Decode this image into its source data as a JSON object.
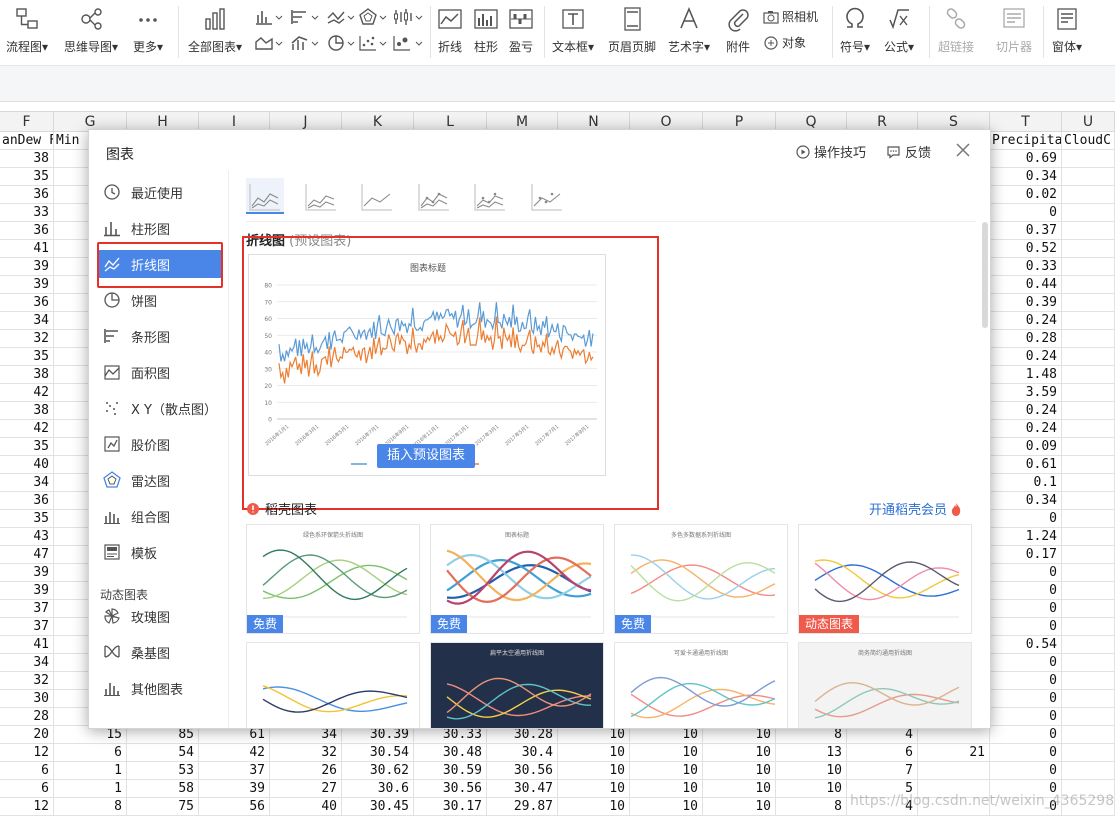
{
  "ribbon": {
    "items": [
      {
        "label": "流程图▾",
        "icon": "flowchart-icon"
      },
      {
        "label": "思维导图▾",
        "icon": "mindmap-icon"
      },
      {
        "label": "更多▾",
        "icon": "more-dots-icon"
      },
      {
        "label": "全部图表▾",
        "icon": "all-charts-icon"
      },
      {
        "label": "折线",
        "icon": "line-chart-icon"
      },
      {
        "label": "柱形",
        "icon": "column-chart-icon"
      },
      {
        "label": "盈亏",
        "icon": "win-loss-icon"
      },
      {
        "label": "文本框▾",
        "icon": "textbox-icon"
      },
      {
        "label": "页眉页脚",
        "icon": "header-footer-icon"
      },
      {
        "label": "艺术字▾",
        "icon": "wordart-icon"
      },
      {
        "label": "附件",
        "icon": "attachment-icon"
      },
      {
        "label": "照相机",
        "icon": "camera-icon"
      },
      {
        "label": "对象",
        "icon": "object-icon"
      },
      {
        "label": "符号▾",
        "icon": "omega-symbol-icon"
      },
      {
        "label": "公式▾",
        "icon": "formula-icon"
      },
      {
        "label": "超链接",
        "icon": "hyperlink-icon"
      },
      {
        "label": "切片器",
        "icon": "slicer-icon"
      },
      {
        "label": "窗体▾",
        "icon": "form-icon"
      }
    ]
  },
  "columns": [
    "F",
    "G",
    "H",
    "I",
    "J",
    "K",
    "L",
    "M",
    "N",
    "O",
    "P",
    "Q",
    "R",
    "S",
    "T",
    "U"
  ],
  "header_row": {
    "F": "anDew F",
    "G": "Min",
    "T": "Precipita",
    "U": "CloudC"
  },
  "col_F": [
    "38",
    "35",
    "36",
    "33",
    "36",
    "41",
    "39",
    "39",
    "36",
    "34",
    "32",
    "35",
    "38",
    "42",
    "38",
    "42",
    "35",
    "40",
    "34",
    "36",
    "35",
    "43",
    "47",
    "39",
    "39",
    "37",
    "37",
    "41",
    "34",
    "32",
    "30",
    "28",
    "20",
    "12",
    "6",
    "6",
    "12"
  ],
  "col_T": [
    "0.69",
    "0.34",
    "0.02",
    "0",
    "0.37",
    "0.52",
    "0.33",
    "0.44",
    "0.39",
    "0.24",
    "0.28",
    "0.24",
    "1.48",
    "3.59",
    "0.24",
    "0.24",
    "0.09",
    "0.61",
    "0.1",
    "0.34",
    "0",
    "1.24",
    "0.17",
    "0",
    "0",
    "0",
    "0",
    "0.54",
    "0",
    "0",
    "0",
    "0",
    "0",
    "0",
    "0",
    "0",
    "0"
  ],
  "bottom_rows": [
    {
      "F": "20",
      "G": "15",
      "H": "85",
      "I": "61",
      "J": "34",
      "K": "30.39",
      "L": "30.33",
      "M": "30.28",
      "N": "10",
      "O": "10",
      "P": "10",
      "Q": "8",
      "R": "4",
      "S": "",
      "T": "0"
    },
    {
      "F": "12",
      "G": "6",
      "H": "54",
      "I": "42",
      "J": "32",
      "K": "30.54",
      "L": "30.48",
      "M": "30.4",
      "N": "10",
      "O": "10",
      "P": "10",
      "Q": "13",
      "R": "6",
      "S": "21",
      "T": "0"
    },
    {
      "F": "6",
      "G": "1",
      "H": "53",
      "I": "37",
      "J": "26",
      "K": "30.62",
      "L": "30.59",
      "M": "30.56",
      "N": "10",
      "O": "10",
      "P": "10",
      "Q": "10",
      "R": "7",
      "S": "",
      "T": "0"
    },
    {
      "F": "6",
      "G": "1",
      "H": "58",
      "I": "39",
      "J": "27",
      "K": "30.6",
      "L": "30.56",
      "M": "30.47",
      "N": "10",
      "O": "10",
      "P": "10",
      "Q": "10",
      "R": "5",
      "S": "",
      "T": "0"
    },
    {
      "F": "12",
      "G": "8",
      "H": "75",
      "I": "56",
      "J": "40",
      "K": "30.45",
      "L": "30.17",
      "M": "29.87",
      "N": "10",
      "O": "10",
      "P": "10",
      "Q": "8",
      "R": "4",
      "S": "",
      "T": "0"
    }
  ],
  "dialog": {
    "title": "图表",
    "tips": "操作技巧",
    "feedback": "反馈",
    "sidebar": [
      {
        "label": "最近使用",
        "icon": "clock-icon"
      },
      {
        "label": "柱形图",
        "icon": "column-chart-icon"
      },
      {
        "label": "折线图",
        "icon": "line-chart-icon"
      },
      {
        "label": "饼图",
        "icon": "pie-chart-icon"
      },
      {
        "label": "条形图",
        "icon": "bar-chart-icon"
      },
      {
        "label": "面积图",
        "icon": "area-chart-icon"
      },
      {
        "label": "X Y（散点图）",
        "icon": "scatter-chart-icon"
      },
      {
        "label": "股价图",
        "icon": "stock-chart-icon"
      },
      {
        "label": "雷达图",
        "icon": "radar-chart-icon"
      },
      {
        "label": "组合图",
        "icon": "combo-chart-icon"
      },
      {
        "label": "模板",
        "icon": "template-icon"
      },
      {
        "label": "玫瑰图",
        "icon": "rose-chart-icon"
      },
      {
        "label": "桑基图",
        "icon": "sankey-chart-icon"
      },
      {
        "label": "其他图表",
        "icon": "other-chart-icon"
      }
    ],
    "sidebar_section": "动态图表",
    "section_title": "折线图",
    "section_hint": "(预设图表)",
    "insert_button": "插入预设图表",
    "preview_title": "图表标题",
    "preview_yticks": [
      "80",
      "70",
      "60",
      "50",
      "40",
      "30",
      "20",
      "10",
      "0"
    ],
    "preview_xticks": [
      "2016年1月1",
      "2016年3月1",
      "2016年5月1",
      "2016年7月1",
      "2016年9月1",
      "2016年11月1",
      "2017年1月1",
      "2017年3月1",
      "2017年5月1",
      "2017年7月1",
      "2017年9月1"
    ],
    "daoke_label": "稻壳图表",
    "member_label": "开通稻壳会员",
    "templates": [
      {
        "title": "绿色系环保箭头折线图",
        "badge": "免费"
      },
      {
        "title": "图表标题",
        "badge": "免费"
      },
      {
        "title": "多色多数据系列折线图",
        "badge": "免费"
      },
      {
        "title": "",
        "badge": "动态图表"
      },
      {
        "title": "",
        "badge": ""
      },
      {
        "title": "扁平太空通用折线图",
        "badge": ""
      },
      {
        "title": "可爱卡通通用折线图",
        "badge": ""
      },
      {
        "title": "商务简约通用折线图",
        "badge": ""
      }
    ]
  },
  "colors": {
    "accent": "#4a86e8",
    "highlight": "#e5312a",
    "series_blue": "#5b9bd5",
    "series_orange": "#ed7d31"
  },
  "watermark": "https://blog.csdn.net/weixin_43652989"
}
